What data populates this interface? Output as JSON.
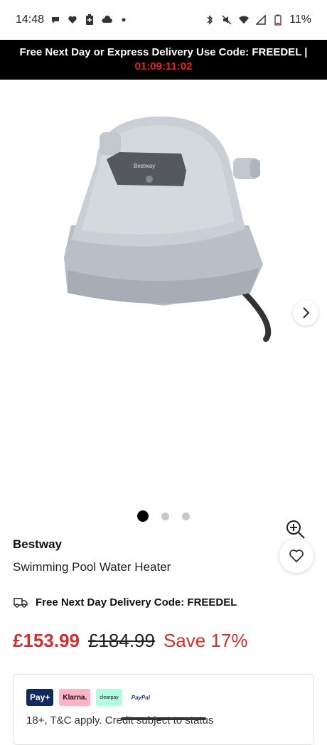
{
  "status_bar": {
    "time": "14:48",
    "battery": "11%",
    "left_icons": [
      "chat-icon",
      "heart-pulse-icon",
      "battery-plus-icon",
      "cloud-icon",
      "dot-icon"
    ],
    "right_icons": [
      "bluetooth-icon",
      "mute-icon",
      "wifi-icon",
      "signal-icon",
      "battery-icon"
    ]
  },
  "promo": {
    "text": "Free Next Day or Express Delivery Use Code: FREEDEL |",
    "timer": "01:09:11:02"
  },
  "product_image": {
    "brand_plate": "Bestway",
    "image_count": 3,
    "active_index": 0
  },
  "product": {
    "brand": "Bestway",
    "name": "Swimming Pool Water Heater"
  },
  "delivery": {
    "text": "Free Next Day Delivery Code: FREEDEL"
  },
  "price": {
    "current": "£153.99",
    "old": "£184.99",
    "save": "Save 17%"
  },
  "payment": {
    "logos": [
      "Pay+",
      "Klarna.",
      "clearpay",
      "PayPal"
    ],
    "terms": "18+, T&C apply. Credit subject to status"
  },
  "colors": {
    "accent_red": "#d32f2f",
    "timer_red": "#e8211c",
    "banner_bg": "#000000"
  }
}
